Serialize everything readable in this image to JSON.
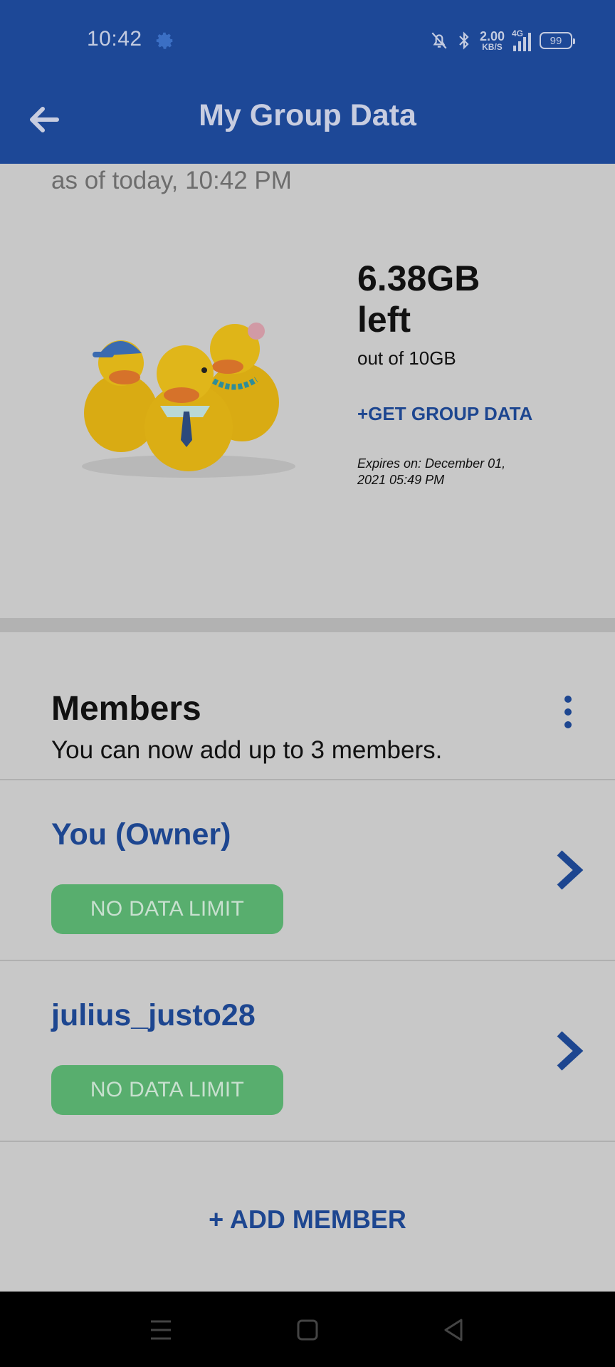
{
  "status_bar": {
    "time": "10:42",
    "net_speed_value": "2.00",
    "net_speed_unit": "KB/S",
    "network": "4G",
    "battery": "99"
  },
  "header": {
    "title": "My Group Data"
  },
  "summary": {
    "as_of": "as of today, 10:42 PM",
    "data_left": "6.38GB left",
    "data_total": "out of 10GB",
    "get_data_label": "+GET GROUP DATA",
    "expires": "Expires on: December 01, 2021 05:49 PM"
  },
  "members": {
    "title": "Members",
    "subtitle": "You can now add up to 3 members.",
    "list": [
      {
        "name": "You (Owner)",
        "limit": "NO DATA LIMIT"
      },
      {
        "name": "julius_justo28",
        "limit": "NO DATA LIMIT"
      }
    ],
    "add_label": "+ ADD MEMBER"
  },
  "colors": {
    "brand_blue": "#1d4897",
    "badge_green": "#58ae6e",
    "background": "#c8c8c8"
  },
  "icons": {
    "back": "arrow-left-icon",
    "settings": "gear-icon",
    "more": "kebab-icon",
    "chevron": "chevron-right-icon"
  }
}
